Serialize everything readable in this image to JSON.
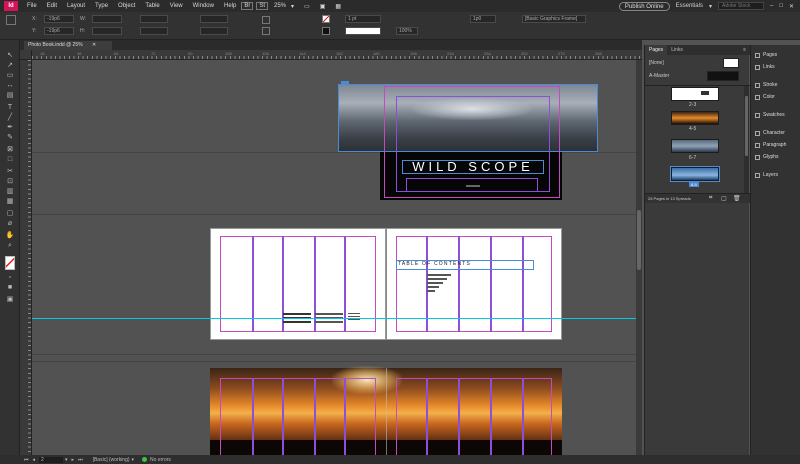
{
  "app": {
    "logo": "Id",
    "menus": [
      "File",
      "Edit",
      "Layout",
      "Type",
      "Object",
      "Table",
      "View",
      "Window",
      "Help"
    ],
    "zoom": "25%",
    "publish_label": "Publish Online",
    "workspace": "Essentials",
    "search_placeholder": "Adobe Stock"
  },
  "control": {
    "x_label": "X:",
    "y_label": "Y:",
    "w_label": "W:",
    "h_label": "H:",
    "x_value": "-19p6",
    "y_value": "-19p6",
    "stroke_weight": "1 pt",
    "opacity": "100%",
    "fitting": "1p0",
    "object_style": "[Basic Graphics Frame]"
  },
  "document": {
    "tab_title": "Photo Book.indd @ 25%",
    "title_text": "WILD SCOPE",
    "toc_text": "TABLE OF CONTENTS",
    "ruler_labels": [
      "18",
      "36",
      "54",
      "72",
      "90",
      "108",
      "126",
      "144",
      "162",
      "180",
      "198",
      "216",
      "234",
      "252",
      "270",
      "288"
    ]
  },
  "pages_panel": {
    "tabs": [
      "Pages",
      "Links"
    ],
    "none_label": "[None]",
    "master_label": "A-Master",
    "spreads": [
      "2-3",
      "4-5",
      "6-7"
    ],
    "selected_badge": "8-9",
    "footer": "25 Pages in 13 Spreads"
  },
  "dock": {
    "items": [
      "Pages",
      "Links",
      "Stroke",
      "Color",
      "Swatches",
      "Character",
      "Paragraph",
      "Glyphs",
      "Layers"
    ]
  },
  "status": {
    "page": "2",
    "preflight_profile": "[Basic] (working)",
    "errors": "No errors"
  },
  "colors": {
    "accent": "#d4145a",
    "margin": "#c24bc2",
    "column": "#8d4fd6",
    "frame": "#4b8bd6",
    "guide": "#00c8e8"
  }
}
